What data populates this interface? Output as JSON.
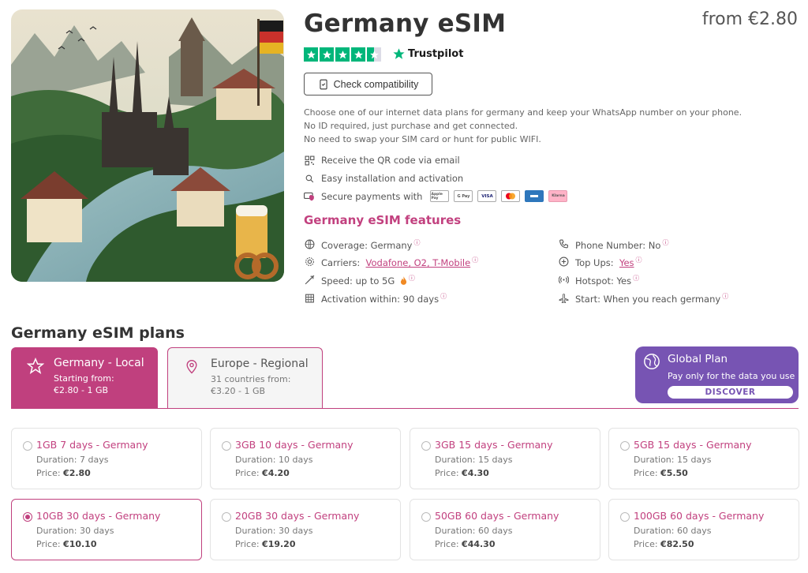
{
  "product": {
    "title": "Germany eSIM",
    "price_from": "from €2.80",
    "rating_stars": 4.5,
    "trustpilot_label": "Trustpilot",
    "check_compat_label": "Check compatibility",
    "description": [
      "Choose one of our internet data plans for germany and keep your WhatsApp number on your phone.",
      "No ID required, just purchase and get connected.",
      "No need to swap your SIM card or hunt for public WIFI."
    ],
    "benefits": {
      "qr": "Receive the QR code via email",
      "install": "Easy installation and activation",
      "payments": "Secure payments with"
    },
    "payment_methods": [
      "Apple Pay",
      "G Pay",
      "VISA",
      "Mastercard",
      "Amex",
      "Klarna"
    ]
  },
  "features": {
    "title": "Germany eSIM features",
    "coverage_label": "Coverage: Germany",
    "carriers_label": "Carriers:",
    "carriers_value": "Vodafone, O2, T-Mobile",
    "speed_label": "Speed: up to 5G",
    "activation_label": "Activation within: 90 days",
    "phone_label": "Phone Number: No",
    "topups_label": "Top Ups:",
    "topups_value": "Yes",
    "hotspot_label": "Hotspot: Yes",
    "start_label": "Start: When you reach germany",
    "info_glyph": "ⓘ"
  },
  "plans": {
    "title": "Germany eSIM plans",
    "tabs": [
      {
        "title": "Germany - Local",
        "sub1": "Starting from:",
        "sub2": "€2.80 - 1 GB"
      },
      {
        "title": "Europe - Regional",
        "sub1": "31 countries from:",
        "sub2": "€3.20 - 1 GB"
      }
    ],
    "global": {
      "title": "Global Plan",
      "sub": "Pay only for the data you use",
      "button": "DISCOVER"
    },
    "price_prefix": "Price:",
    "items": [
      {
        "title": "1GB 7 days - Germany",
        "duration": "Duration: 7 days",
        "price": "€2.80",
        "selected": false
      },
      {
        "title": "3GB 10 days - Germany",
        "duration": "Duration: 10 days",
        "price": "€4.20",
        "selected": false
      },
      {
        "title": "3GB 15 days - Germany",
        "duration": "Duration: 15 days",
        "price": "€4.30",
        "selected": false
      },
      {
        "title": "5GB 15 days - Germany",
        "duration": "Duration: 15 days",
        "price": "€5.50",
        "selected": false
      },
      {
        "title": "10GB 30 days - Germany",
        "duration": "Duration: 30 days",
        "price": "€10.10",
        "selected": true
      },
      {
        "title": "20GB 30 days - Germany",
        "duration": "Duration: 30 days",
        "price": "€19.20",
        "selected": false
      },
      {
        "title": "50GB 60 days - Germany",
        "duration": "Duration: 60 days",
        "price": "€44.30",
        "selected": false
      },
      {
        "title": "100GB 60 days - Germany",
        "duration": "Duration: 60 days",
        "price": "€82.50",
        "selected": false
      }
    ]
  },
  "colors": {
    "accent": "#c0407e",
    "global": "#7754b3",
    "trustpilot": "#00b67a"
  }
}
